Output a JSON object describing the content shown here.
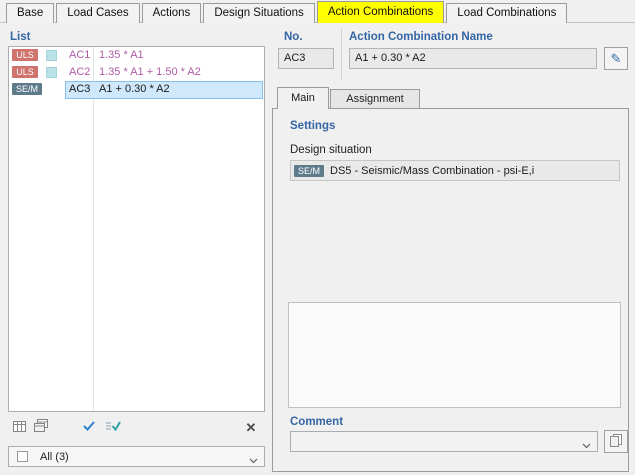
{
  "tabs": [
    {
      "label": "Base"
    },
    {
      "label": "Load Cases"
    },
    {
      "label": "Actions"
    },
    {
      "label": "Design Situations"
    },
    {
      "label": "Action Combinations"
    },
    {
      "label": "Load Combinations"
    }
  ],
  "list": {
    "title": "List",
    "rows": [
      {
        "badge": "ULS",
        "id": "AC1",
        "formula": "1.35 * A1"
      },
      {
        "badge": "ULS",
        "id": "AC2",
        "formula": "1.35 * A1 + 1.50 * A2"
      },
      {
        "badge": "SE/M",
        "id": "AC3",
        "formula": "A1 + 0.30 * A2"
      }
    ],
    "filter_value": "All (3)"
  },
  "detail": {
    "no_label": "No.",
    "no_value": "AC3",
    "name_label": "Action Combination Name",
    "name_value": "A1 + 0.30 * A2",
    "tabs": [
      {
        "label": "Main"
      },
      {
        "label": "Assignment"
      }
    ],
    "settings_label": "Settings",
    "design_situation_label": "Design situation",
    "design_situation_badge": "SE/M",
    "design_situation_value": "DS5 - Seismic/Mass Combination - psi-E,i",
    "comment_label": "Comment",
    "comment_value": ""
  },
  "colors": {
    "active_tab": "#ffff00",
    "uls_badge": "#cf736c",
    "sem_badge": "#5e7b8c",
    "swatch_cyan": "#b9e3e8",
    "combination_text": "#b05ba5",
    "selection_fill": "#cfe8fb",
    "selection_border": "#88bfe8",
    "label_blue": "#3465a4"
  }
}
